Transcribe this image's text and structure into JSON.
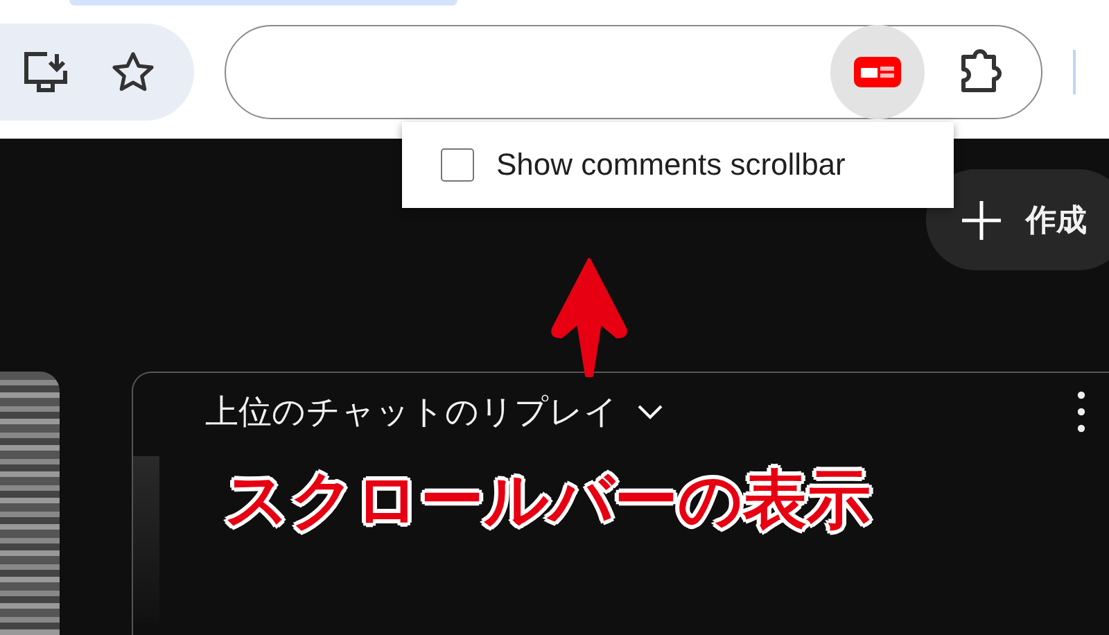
{
  "settings_popup": {
    "label": "Show comments scrollbar",
    "checked": false
  },
  "create_button": {
    "label": "作成"
  },
  "chat": {
    "title": "上位のチャットのリプレイ"
  },
  "annotation": {
    "text": "スクロールバーの表示"
  }
}
